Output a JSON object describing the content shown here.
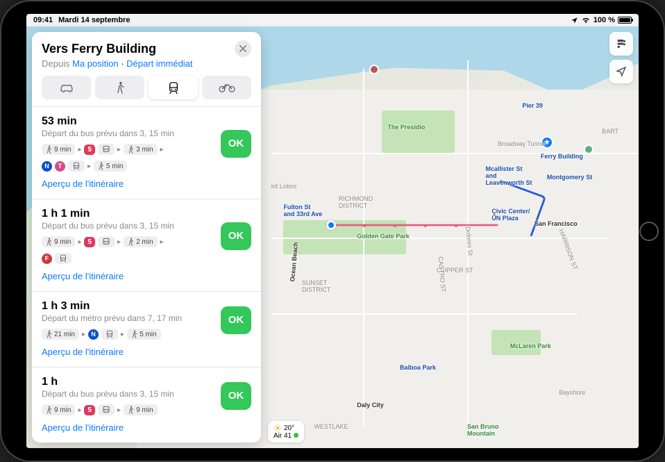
{
  "status": {
    "time": "09:41",
    "date": "Mardi 14 septembre",
    "battery": "100 %"
  },
  "panel": {
    "title": "Vers Ferry Building",
    "from_label": "Depuis",
    "from_value": "Ma position",
    "depart_label": "Départ immédiat",
    "go_label": "OK",
    "preview_label": "Aperçu de l'itinéraire"
  },
  "mode_icons": [
    "car",
    "walk",
    "transit",
    "bike"
  ],
  "routes": [
    {
      "duration": "53 min",
      "depart": "Départ du bus prévu dans 3, 15 min",
      "steps_rows": [
        [
          {
            "type": "walk",
            "text": "9 min"
          },
          {
            "type": "arrow"
          },
          {
            "type": "line",
            "text": "5",
            "color": "#e0395c"
          },
          {
            "type": "bus"
          },
          {
            "type": "arrow"
          },
          {
            "type": "walk",
            "text": "3 min"
          },
          {
            "type": "arrow"
          }
        ],
        [
          {
            "type": "circle",
            "text": "N",
            "color": "#0a50c8"
          },
          {
            "type": "circle",
            "text": "T",
            "color": "#d94a8a"
          },
          {
            "type": "rail"
          },
          {
            "type": "arrow"
          },
          {
            "type": "walk",
            "text": "5 min"
          }
        ]
      ]
    },
    {
      "duration": "1 h 1 min",
      "depart": "Départ du bus prévu dans 3, 15 min",
      "steps_rows": [
        [
          {
            "type": "walk",
            "text": "9 min"
          },
          {
            "type": "arrow"
          },
          {
            "type": "line",
            "text": "5",
            "color": "#e0395c"
          },
          {
            "type": "bus"
          },
          {
            "type": "arrow"
          },
          {
            "type": "walk",
            "text": "2 min"
          },
          {
            "type": "arrow"
          }
        ],
        [
          {
            "type": "circle",
            "text": "F",
            "color": "#c93a3a"
          },
          {
            "type": "rail"
          }
        ]
      ]
    },
    {
      "duration": "1 h 3 min",
      "depart": "Départ du métro prévu dans 7, 17 min",
      "steps_rows": [
        [
          {
            "type": "walk",
            "text": "21 min"
          },
          {
            "type": "arrow"
          },
          {
            "type": "circle",
            "text": "N",
            "color": "#0a50c8"
          },
          {
            "type": "rail"
          },
          {
            "type": "arrow"
          },
          {
            "type": "walk",
            "text": "5 min"
          }
        ]
      ]
    },
    {
      "duration": "1 h",
      "depart": "Départ du bus prévu dans 3, 15 min",
      "steps_rows": [
        [
          {
            "type": "walk",
            "text": "9 min"
          },
          {
            "type": "arrow"
          },
          {
            "type": "line",
            "text": "5",
            "color": "#e0395c"
          },
          {
            "type": "bus"
          },
          {
            "type": "arrow"
          },
          {
            "type": "walk",
            "text": "9 min"
          }
        ]
      ]
    }
  ],
  "weather": {
    "temp": "20°",
    "aqi": "Air 41"
  },
  "maplabels": {
    "ferry": "Ferry Building",
    "montgomery": "Montgomery St",
    "mcallister": "Mcallister St\nand\nLeavenworth St",
    "civic": "Civic Center/\nUN Plaza",
    "fulton": "Fulton St\nand 33rd Ave",
    "ggpark": "Golden Gate Park",
    "presidio": "The Presidio",
    "sf": "San Francisco",
    "richmond": "RICHMOND\nDISTRICT",
    "sunset": "SUNSET\nDISTRICT",
    "clipper": "CLIPPER ST",
    "broadway": "Broadway Tunnel",
    "pier39": "Pier 39",
    "mclaren": "McLaren Park",
    "balboa": "Balboa Park",
    "bayshore": "Bayshore",
    "dalycity": "Daly City",
    "sanbruno": "San Bruno\nMountain",
    "westlake": "WESTLAKE",
    "dolores": "Dolores St",
    "harrison": "HARRISON ST",
    "castro": "CASTRO ST",
    "ocean": "Ocean Beach",
    "lobos": "int Lobos",
    "bart": "BART"
  }
}
